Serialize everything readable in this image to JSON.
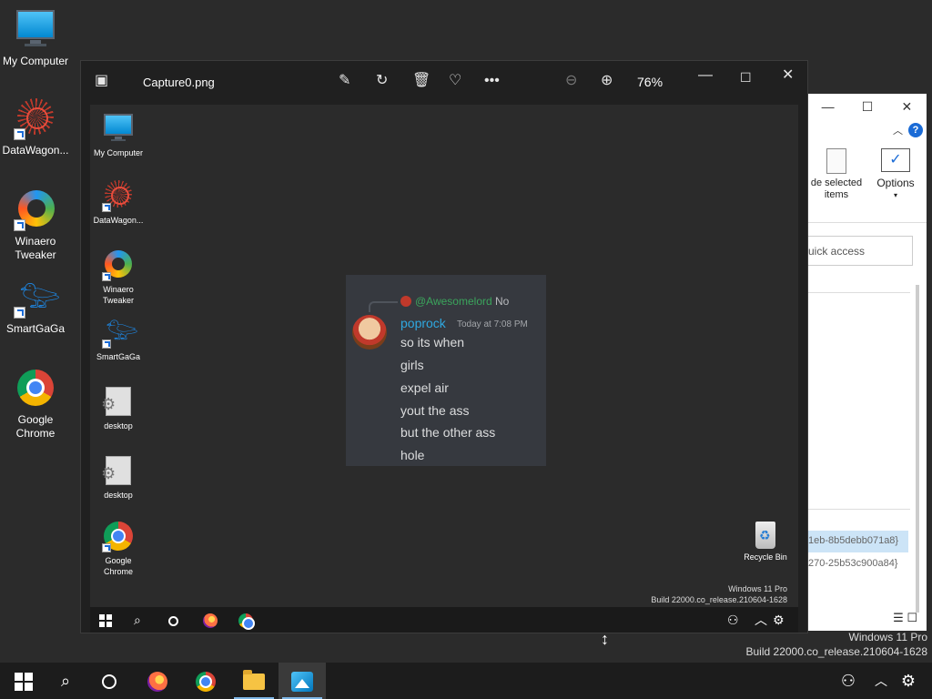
{
  "desktop": {
    "icons": [
      {
        "label": "My Computer"
      },
      {
        "label": "DataWagon..."
      },
      {
        "label": "Winaero Tweaker"
      },
      {
        "label": "SmartGaGa"
      },
      {
        "label": "Google Chrome"
      }
    ],
    "watermark_line1": "Windows 11 Pro",
    "watermark_line2": "Build 22000.co_release.210604-1628"
  },
  "explorer": {
    "hide_selected": "de selected items",
    "options_label": "Options",
    "search_placeholder": "uick access",
    "row1": "1eb-8b5debb071a8}",
    "row2": "270-25b53c900a84}"
  },
  "photos": {
    "filename": "Capture0.png",
    "zoom": "76%",
    "inner_icons": [
      {
        "label": "My Computer"
      },
      {
        "label": "DataWagon..."
      },
      {
        "label": "Winaero Tweaker"
      },
      {
        "label": "SmartGaGa"
      },
      {
        "label": "desktop"
      },
      {
        "label": "desktop"
      },
      {
        "label": "Google Chrome"
      }
    ],
    "recycle_label": "Recycle Bin",
    "inner_watermark_line1": "Windows 11 Pro",
    "inner_watermark_line2": "Build 22000.co_release.210604-1628",
    "chat": {
      "reply_mention": "@Awesomelord",
      "reply_text": "No",
      "username": "poprock",
      "timestamp": "Today at 7:08 PM",
      "lines": [
        "so its when",
        "girls",
        "expel air",
        "yout the ass",
        "but the other ass",
        "hole"
      ]
    }
  },
  "colors": {
    "desktop_bg": "#2b2b2b",
    "taskbar_bg": "#1c1c1c",
    "chat_bg": "#36393f",
    "mention_green": "#3ba55c",
    "username_blue": "#2fa8e0"
  }
}
